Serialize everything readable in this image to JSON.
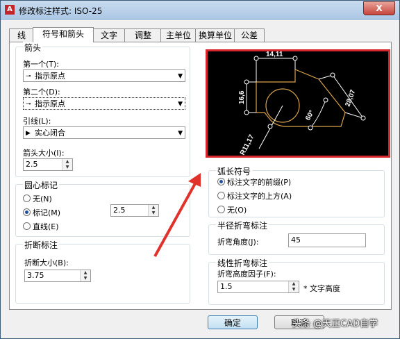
{
  "window": {
    "title": "修改标注样式: ISO-25",
    "close_label": "X"
  },
  "tabs": [
    {
      "label": "线"
    },
    {
      "label": "符号和箭头"
    },
    {
      "label": "文字"
    },
    {
      "label": "调整"
    },
    {
      "label": "主单位"
    },
    {
      "label": "换算单位"
    },
    {
      "label": "公差"
    }
  ],
  "arrowheads": {
    "title": "箭头",
    "first_label": "第一个(T):",
    "first_value": "指示原点",
    "second_label": "第二个(D):",
    "second_value": "指示原点",
    "leader_label": "引线(L):",
    "leader_value": "实心闭合",
    "size_label": "箭头大小(I):",
    "size_value": "2.5"
  },
  "center_marks": {
    "title": "圆心标记",
    "options": [
      {
        "label": "无(N)"
      },
      {
        "label": "标记(M)"
      },
      {
        "label": "直线(E)"
      }
    ],
    "selected": "标记(M)",
    "size_value": "2.5"
  },
  "dim_break": {
    "title": "折断标注",
    "size_label": "折断大小(B):",
    "size_value": "3.75"
  },
  "preview": {
    "dim_top": "14,11",
    "dim_left": "16,6",
    "dim_right": "28,07",
    "dim_angle": "60°",
    "dim_radius": "R11,17"
  },
  "arc_length": {
    "title": "弧长符号",
    "options": [
      {
        "label": "标注文字的前缀(P)"
      },
      {
        "label": "标注文字的上方(A)"
      },
      {
        "label": "无(O)"
      }
    ],
    "selected": "标注文字的前缀(P)"
  },
  "radius_jog": {
    "title": "半径折弯标注",
    "angle_label": "折弯角度(J):",
    "angle_value": "45"
  },
  "linear_jog": {
    "title": "线性折弯标注",
    "height_label": "折弯高度因子(F):",
    "height_value": "1.5",
    "text_height_label": "* 文字高度"
  },
  "buttons": {
    "ok": "确定",
    "cancel": "取消"
  },
  "watermark": "头条 @天正CAD自学",
  "colors": {
    "preview_border": "#d7262c",
    "preview_line": "#ffffff",
    "preview_orange": "#d9a24a",
    "arrow": "#e0312b"
  }
}
